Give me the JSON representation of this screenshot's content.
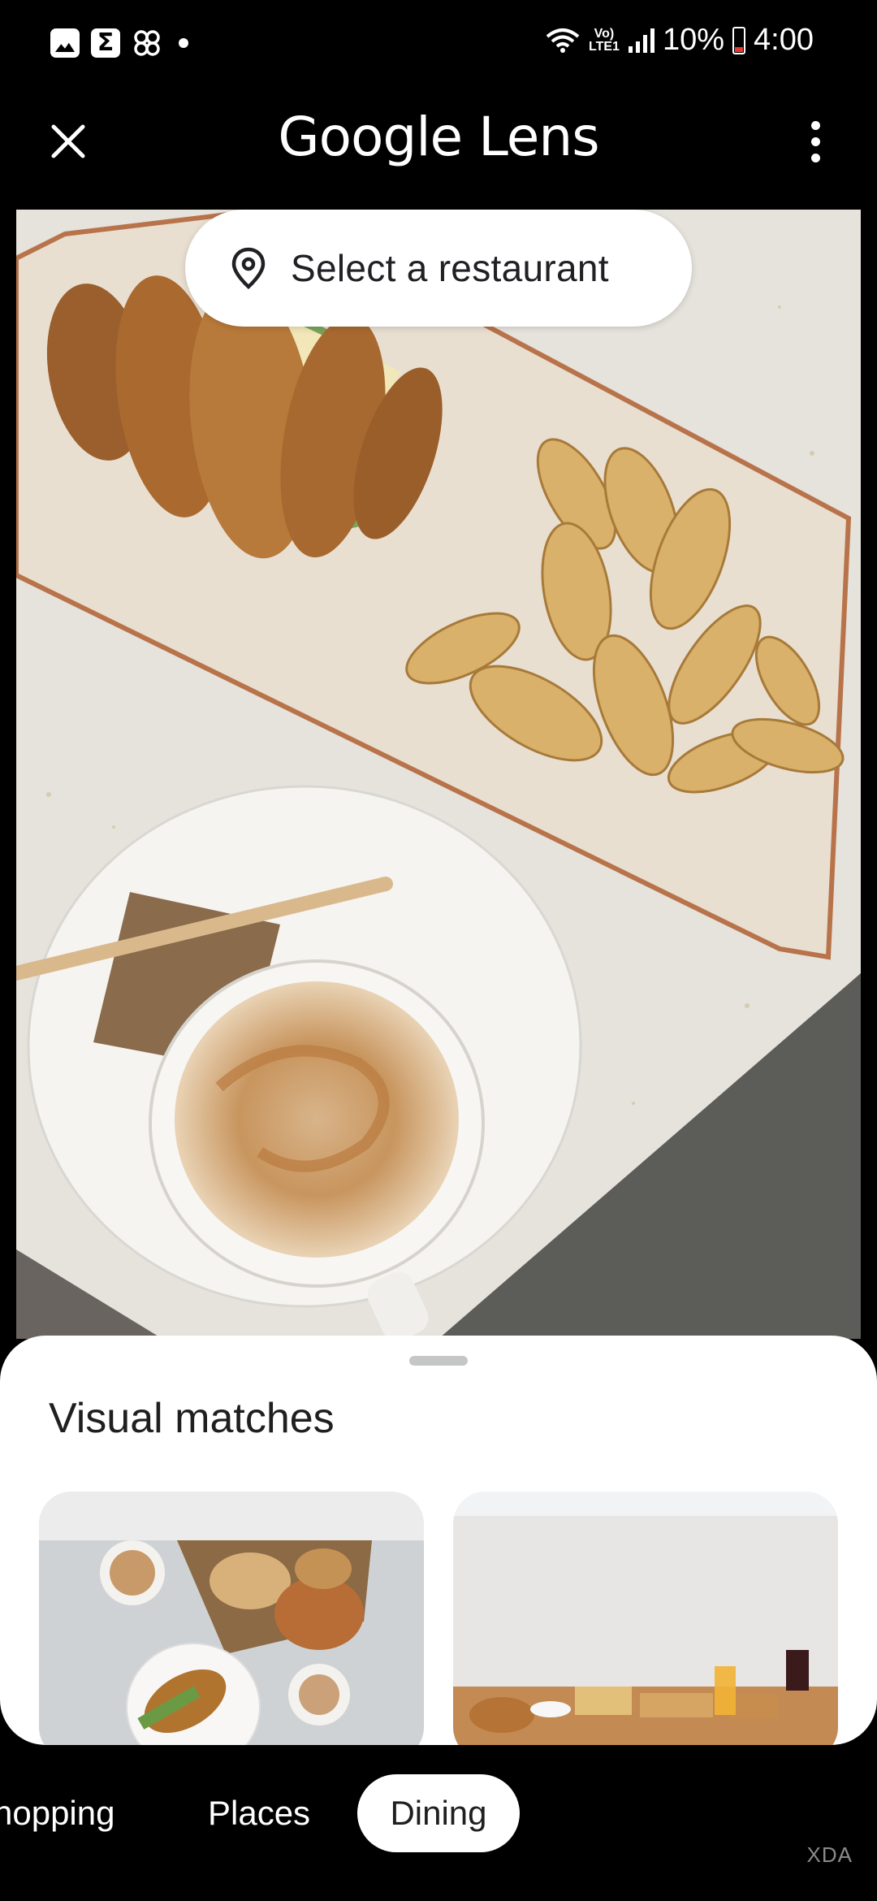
{
  "status_bar": {
    "battery_percent": "10%",
    "time": "4:00",
    "network_label": "Vo) LTE1",
    "icons": [
      "gallery-icon",
      "sigma-app-icon",
      "pinwheel-icon",
      "notification-dot",
      "wifi-icon",
      "signal-icon",
      "battery-icon"
    ]
  },
  "app_bar": {
    "title": "Google Lens",
    "close_icon": "close-icon",
    "more_icon": "more-vert-icon"
  },
  "restaurant_chip": {
    "label": "Select a restaurant",
    "icon": "location-pin-icon"
  },
  "sheet": {
    "title": "Visual matches"
  },
  "tabs": {
    "items": [
      {
        "label": "Shopping",
        "selected": false
      },
      {
        "label": "Places",
        "selected": false
      },
      {
        "label": "Dining",
        "selected": true
      }
    ],
    "visible_shopping_text": "hopping"
  },
  "watermark": "XDA",
  "colors": {
    "background": "#000000",
    "sheet": "#ffffff",
    "selected_tab": "#ffffff",
    "battery_low": "#e53935"
  }
}
